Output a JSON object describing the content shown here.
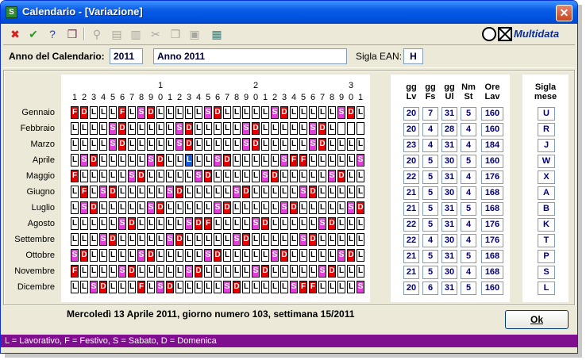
{
  "window": {
    "title": "Calendario - [Variazione]",
    "close_glyph": "✕"
  },
  "toolbar": {
    "buttons": [
      {
        "icon": "cancel-icon",
        "glyph": "✖",
        "color": "#d61e1e",
        "enabled": true
      },
      {
        "icon": "confirm-icon",
        "glyph": "✔",
        "color": "#22a022",
        "enabled": true
      },
      {
        "icon": "help-icon",
        "glyph": "?",
        "color": "#1f3fbf",
        "enabled": true
      },
      {
        "icon": "book-icon",
        "glyph": "❒",
        "color": "#8a2a6a",
        "enabled": true
      },
      {
        "icon": "binoculars-icon",
        "glyph": "⚲",
        "enabled": false
      },
      {
        "icon": "page-icon",
        "glyph": "▤",
        "enabled": false
      },
      {
        "icon": "page-next-icon",
        "glyph": "▥",
        "enabled": false
      },
      {
        "icon": "cut-icon",
        "glyph": "✂",
        "enabled": false
      },
      {
        "icon": "copy-icon",
        "glyph": "❐",
        "enabled": false
      },
      {
        "icon": "paste-icon",
        "glyph": "▣",
        "enabled": false
      },
      {
        "icon": "calculator-icon",
        "glyph": "▦",
        "color": "#1a8f8f",
        "enabled": true
      }
    ],
    "logo_text": "Multidata"
  },
  "header": {
    "year_label": "Anno del Calendario:",
    "year_value": "2011",
    "description_value": "Anno 2011",
    "ean_label": "Sigla EAN:",
    "ean_value": "H"
  },
  "calendar": {
    "ticks_units": [
      "1",
      "2",
      "3",
      "4",
      "5",
      "6",
      "7",
      "8",
      "9",
      "0",
      "1",
      "2",
      "3",
      "4",
      "5",
      "6",
      "7",
      "8",
      "9",
      "0",
      "1",
      "2",
      "3",
      "4",
      "5",
      "6",
      "7",
      "8",
      "9",
      "0",
      "1"
    ],
    "ticks_tens": [
      {
        "day": 10,
        "label": "1"
      },
      {
        "day": 20,
        "label": "2"
      },
      {
        "day": 30,
        "label": "3"
      }
    ],
    "months": [
      {
        "name": "Gennaio",
        "days": "FDLLLFLSDLLLLLSDLLLLLSDLLLLLSDL"
      },
      {
        "name": "Febbraio",
        "days": "LLLLSDLLLLLSDLLLLLSDLLLLLSDL"
      },
      {
        "name": "Marzo",
        "days": "LLLLSDLLLLLSDLLLLLSDLLLLLSDLLLL"
      },
      {
        "name": "Aprile",
        "days": "LSDLLLLLSDLLLLLSDLLLLLSFFLLLLLS"
      },
      {
        "name": "Maggio",
        "days": "FLLLLLSDLLLLLSDLLLLLSDLLLLLSDLL"
      },
      {
        "name": "Giugno",
        "days": "LFLSDLLLLLSDLLLLLSDLLLLLSDLLLLL"
      },
      {
        "name": "Luglio",
        "days": "LSDLLLLLSDLLLLLSDLLLLLSDLLLLLSD"
      },
      {
        "name": "Agosto",
        "days": "LLLLLSDLLLLLSDFLLLLSDLLLLLSDLLL"
      },
      {
        "name": "Settembre",
        "days": "LLLSDLLLLLSDLLLLLSDLLLLLSDLLLLL"
      },
      {
        "name": "Ottobre",
        "days": "SDLLLLLSDLLLLLSDLLLLLSDLLLLLSDL"
      },
      {
        "name": "Novembre",
        "days": "FLLLLSDLLLLLSDLLLLLSDLLLLLSDLLL"
      },
      {
        "name": "Dicembre",
        "days": "LLSDLLLFLSDLLLLLSDLLLLLSFFLLLLS"
      }
    ],
    "selected": {
      "month": 3,
      "day": 13
    },
    "colors": {
      "F": "#e00000",
      "D": "#e40000",
      "S": "#e040d8",
      "L": "#ffffff",
      "selected": "#1a5fd6"
    }
  },
  "stats": {
    "headers": [
      [
        "gg",
        "Lv"
      ],
      [
        "gg",
        "Fs"
      ],
      [
        "gg",
        "Ul"
      ],
      [
        "Nm",
        "St"
      ],
      [
        "Ore",
        "Lav"
      ]
    ],
    "rows": [
      [
        "20",
        "7",
        "31",
        "5",
        "160"
      ],
      [
        "20",
        "4",
        "28",
        "4",
        "160"
      ],
      [
        "23",
        "4",
        "31",
        "4",
        "184"
      ],
      [
        "20",
        "5",
        "30",
        "5",
        "160"
      ],
      [
        "22",
        "5",
        "31",
        "4",
        "176"
      ],
      [
        "21",
        "5",
        "30",
        "4",
        "168"
      ],
      [
        "21",
        "5",
        "31",
        "5",
        "168"
      ],
      [
        "22",
        "5",
        "31",
        "4",
        "176"
      ],
      [
        "22",
        "4",
        "30",
        "4",
        "176"
      ],
      [
        "21",
        "5",
        "31",
        "5",
        "168"
      ],
      [
        "21",
        "5",
        "30",
        "4",
        "168"
      ],
      [
        "20",
        "6",
        "31",
        "5",
        "160"
      ]
    ]
  },
  "sigla": {
    "header": [
      "Sigla",
      "mese"
    ],
    "values": [
      "U",
      "R",
      "J",
      "W",
      "X",
      "A",
      "B",
      "K",
      "T",
      "P",
      "S",
      "L"
    ]
  },
  "footer": {
    "date_text": "Mercoledì 13 Aprile 2011, giorno numero 103, settimana 15/2011",
    "ok_label": "Ok"
  },
  "statusbar": {
    "legend": "L = Lavorativo, F = Festivo, S = Sabato, D = Domenica"
  }
}
